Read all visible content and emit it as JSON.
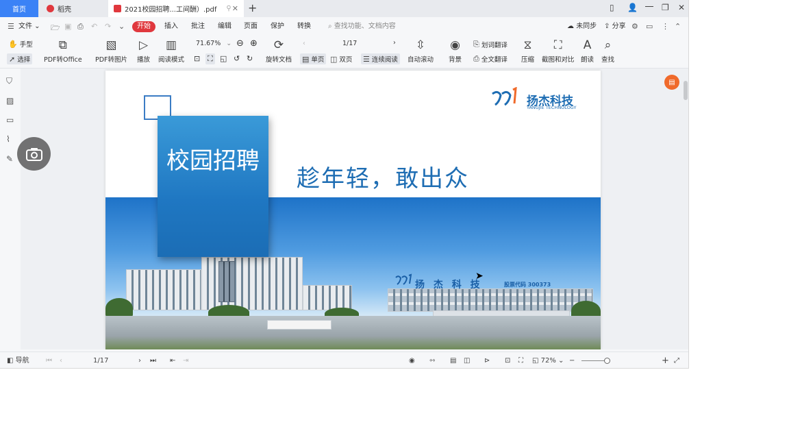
{
  "tabs": {
    "home": "首页",
    "daoke": "稻壳",
    "pdf": "2021校园招聘...工间酬）.pdf",
    "new_tab": "+"
  },
  "window_controls": {
    "minimize": "─",
    "restore": "❐",
    "close": "✕"
  },
  "menu": {
    "file": "文件",
    "start": "开始",
    "insert": "插入",
    "annotate": "批注",
    "edit": "编辑",
    "page": "页面",
    "protect": "保护",
    "convert": "转换",
    "search_placeholder": "查找功能、文档内容",
    "sync": "未同步",
    "share": "分享"
  },
  "toolbar": {
    "hand": "手型",
    "select": "选择",
    "pdf_to_office": "PDF转Office",
    "pdf_to_image": "PDF转图片",
    "play": "播放",
    "read_mode": "阅读模式",
    "zoom_value": "71.67%",
    "page_indicator": "1/17",
    "rotate": "旋转文档",
    "single_page": "单页",
    "double_page": "双页",
    "continuous": "连续阅读",
    "auto_scroll": "自动滚动",
    "background": "背景",
    "word_translate": "划词翻译",
    "full_translate": "全文翻译",
    "compress": "压缩",
    "screenshot_compare": "截图和对比",
    "read_aloud": "朗读",
    "find": "查找"
  },
  "document": {
    "title_box": "校园招聘",
    "slogan": "趁年轻，敢出众",
    "logo_cn": "扬杰科技",
    "logo_en": "YANGJIE TECHNOLOGY",
    "building_sign": "扬 杰 科 技",
    "stock_code": "股票代码 300373"
  },
  "statusbar": {
    "nav": "导航",
    "page": "1/17",
    "zoom": "72%"
  },
  "colors": {
    "accent": "#3b82f6",
    "start_red": "#e0383e",
    "brand_blue": "#1e6db3",
    "fab_orange": "#f06a2b"
  }
}
